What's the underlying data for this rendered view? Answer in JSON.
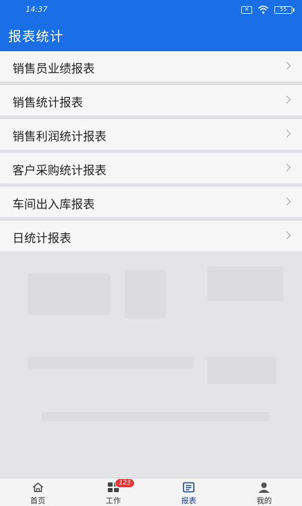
{
  "status_bar": {
    "time": "14:37",
    "battery": "55"
  },
  "header": {
    "title": "报表统计"
  },
  "menu": {
    "items": [
      {
        "label": "销售员业绩报表"
      },
      {
        "label": "销售统计报表"
      },
      {
        "label": "销售利润统计报表"
      },
      {
        "label": "客户采购统计报表"
      },
      {
        "label": "车间出入库报表"
      },
      {
        "label": "日统计报表"
      }
    ]
  },
  "tabbar": {
    "tabs": [
      {
        "label": "首页",
        "icon": "home-icon"
      },
      {
        "label": "工作",
        "icon": "grid-icon",
        "badge": "123"
      },
      {
        "label": "报表",
        "icon": "report-icon",
        "active": true
      },
      {
        "label": "我的",
        "icon": "user-icon"
      }
    ]
  },
  "colors": {
    "accent": "#1a6fe6",
    "badge": "#e53935",
    "background": "#e6e6e8"
  }
}
